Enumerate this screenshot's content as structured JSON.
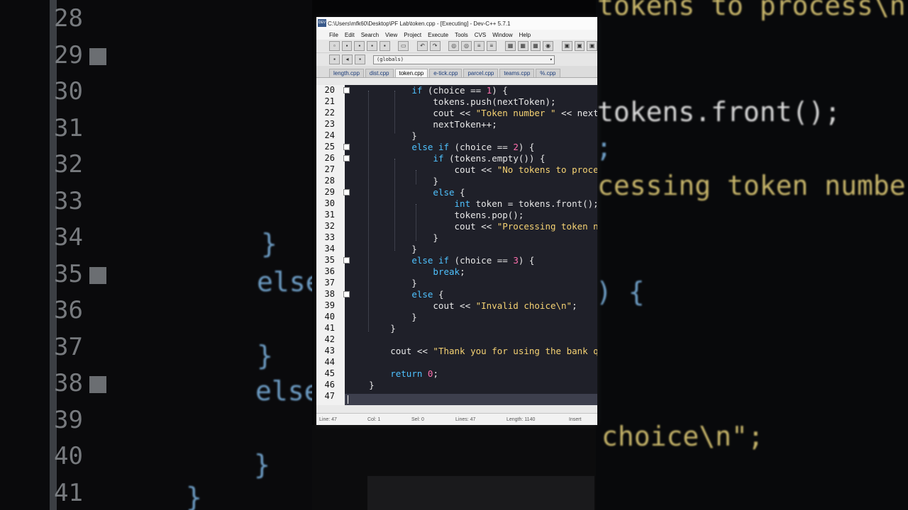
{
  "window": {
    "title": "C:\\Users\\mfk60\\Desktop\\PF Lab\\token.cpp - [Executing] - Dev-C++ 5.7.1",
    "icon_label": "DEV"
  },
  "menu": [
    "File",
    "Edit",
    "Search",
    "View",
    "Project",
    "Execute",
    "Tools",
    "CVS",
    "Window",
    "Help"
  ],
  "toolbar": {
    "scope_select_value": "(globals)"
  },
  "tabs": [
    {
      "label": "length.cpp",
      "active": false
    },
    {
      "label": "dist.cpp",
      "active": false
    },
    {
      "label": "token.cpp",
      "active": true
    },
    {
      "label": "e-tick.cpp",
      "active": false
    },
    {
      "label": "parcel.cpp",
      "active": false
    },
    {
      "label": "teams.cpp",
      "active": false
    },
    {
      "label": "%.cpp",
      "active": false
    }
  ],
  "editor": {
    "lines": [
      {
        "n": "20",
        "fold": true,
        "text": "            if (choice == 1) {"
      },
      {
        "n": "21",
        "fold": false,
        "text": "                tokens.push(nextToken);"
      },
      {
        "n": "22",
        "fold": false,
        "text": "                cout << \"Token number \" << nextToke"
      },
      {
        "n": "23",
        "fold": false,
        "text": "                nextToken++;"
      },
      {
        "n": "24",
        "fold": false,
        "text": "            }"
      },
      {
        "n": "25",
        "fold": true,
        "text": "            else if (choice == 2) {"
      },
      {
        "n": "26",
        "fold": true,
        "text": "                if (tokens.empty()) {"
      },
      {
        "n": "27",
        "fold": false,
        "text": "                    cout << \"No tokens to process\\n"
      },
      {
        "n": "28",
        "fold": false,
        "text": "                }"
      },
      {
        "n": "29",
        "fold": true,
        "text": "                else {"
      },
      {
        "n": "30",
        "fold": false,
        "text": "                    int token = tokens.front();"
      },
      {
        "n": "31",
        "fold": false,
        "text": "                    tokens.pop();"
      },
      {
        "n": "32",
        "fold": false,
        "text": "                    cout << \"Processing token number"
      },
      {
        "n": "33",
        "fold": false,
        "text": "                }"
      },
      {
        "n": "34",
        "fold": false,
        "text": "            }"
      },
      {
        "n": "35",
        "fold": true,
        "text": "            else if (choice == 3) {"
      },
      {
        "n": "36",
        "fold": false,
        "text": "                break;"
      },
      {
        "n": "37",
        "fold": false,
        "text": "            }"
      },
      {
        "n": "38",
        "fold": true,
        "text": "            else {"
      },
      {
        "n": "39",
        "fold": false,
        "text": "                cout << \"Invalid choice\\n\";"
      },
      {
        "n": "40",
        "fold": false,
        "text": "            }"
      },
      {
        "n": "41",
        "fold": false,
        "text": "        }"
      },
      {
        "n": "42",
        "fold": false,
        "text": ""
      },
      {
        "n": "43",
        "fold": false,
        "text": "        cout << \"Thank you for using the bank queue"
      },
      {
        "n": "44",
        "fold": false,
        "text": ""
      },
      {
        "n": "45",
        "fold": false,
        "text": "        return 0;"
      },
      {
        "n": "46",
        "fold": false,
        "text": "    }"
      },
      {
        "n": "47",
        "fold": false,
        "text": ""
      }
    ]
  },
  "status": {
    "line_label": "Line:",
    "line_value": "47",
    "col_label": "Col:",
    "col_value": "1",
    "sel_label": "Sel:",
    "sel_value": "0",
    "lines_label": "Lines:",
    "lines_value": "47",
    "length_label": "Length:",
    "length_value": "1140",
    "mode": "Insert"
  },
  "background": {
    "left_numbers": [
      "28",
      "29",
      "30",
      "31",
      "32",
      "33",
      "34",
      "35",
      "36",
      "37",
      "38",
      "39",
      "40",
      "41"
    ],
    "left_code": [
      "}",
      "else",
      "}",
      "else",
      "}",
      "}"
    ],
    "right_code": [
      "tokens to process\\n",
      "tokens.front();",
      ";",
      "cessing token number",
      ") {",
      "choice\\n\";"
    ]
  },
  "colors": {
    "editor_bg": "#1f2029",
    "keyword": "#4fc2ff",
    "string": "#f5d273",
    "number": "#ff6fae"
  }
}
